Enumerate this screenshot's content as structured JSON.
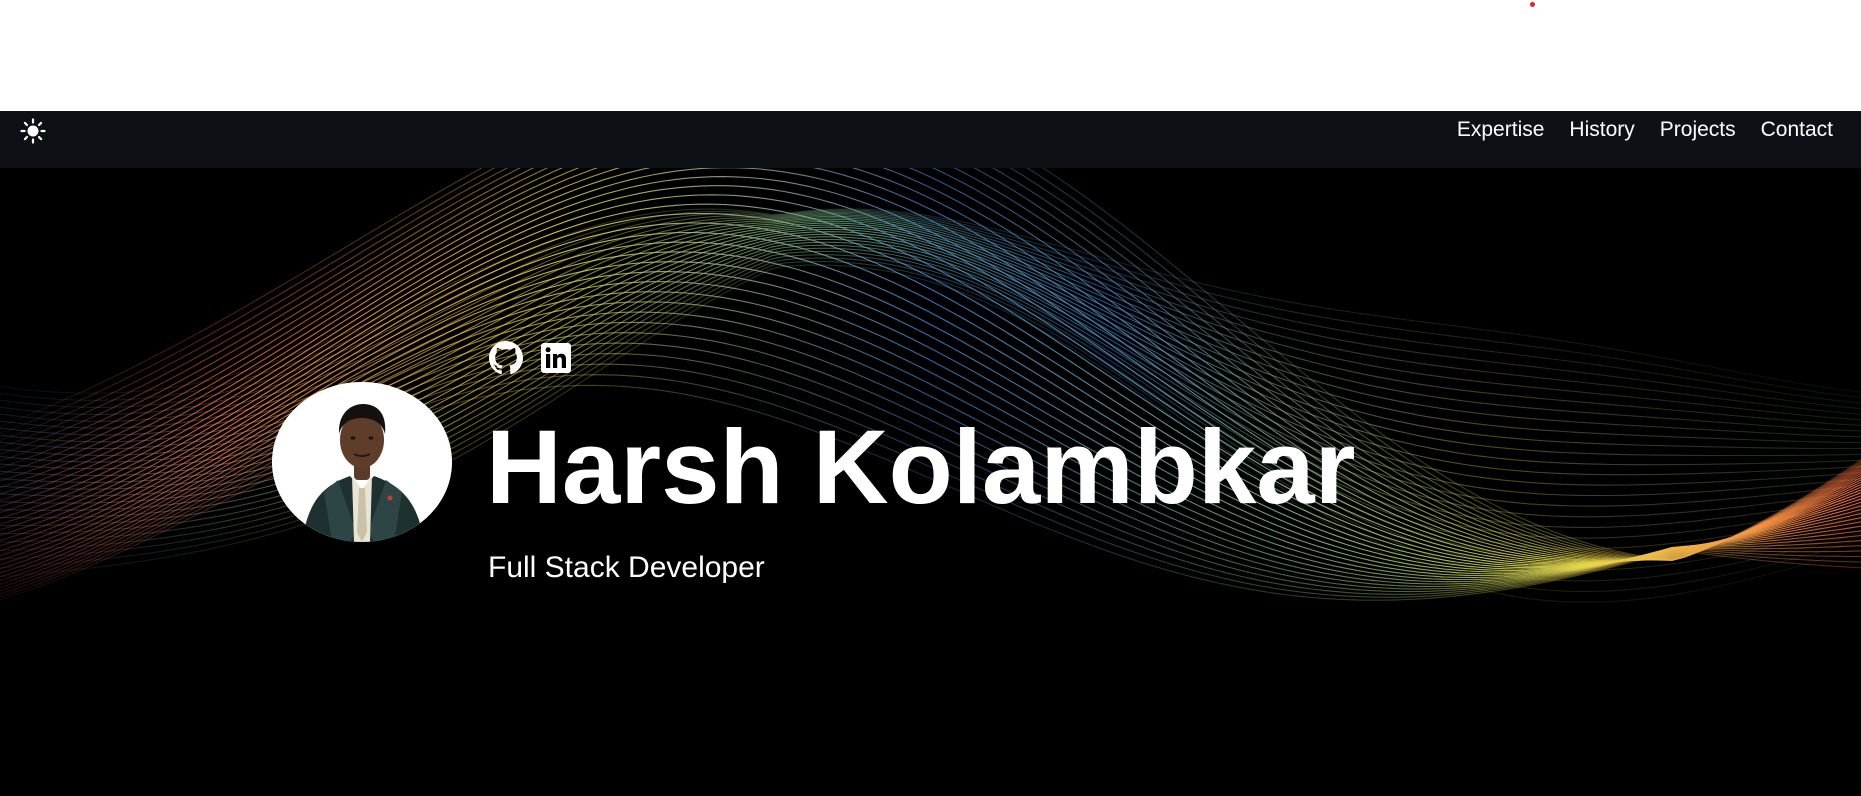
{
  "nav": {
    "theme_toggle_icon": "sun-icon",
    "links": [
      "Expertise",
      "History",
      "Projects",
      "Contact"
    ]
  },
  "hero": {
    "name": "Harsh Kolambkar",
    "subtitle": "Full Stack Developer",
    "social_icons": [
      "github-icon",
      "linkedin-icon"
    ],
    "avatar_icon": "profile-photo"
  },
  "colors": {
    "navbar_bg": "#0d1116",
    "hero_bg": "#000000",
    "text": "#ffffff",
    "wave_orange": "#ff6a3d",
    "wave_yellow": "#e8d84a",
    "wave_blue": "#3d7fd9",
    "wave_green": "#7ab88a",
    "indicator_red": "#e0262b"
  }
}
